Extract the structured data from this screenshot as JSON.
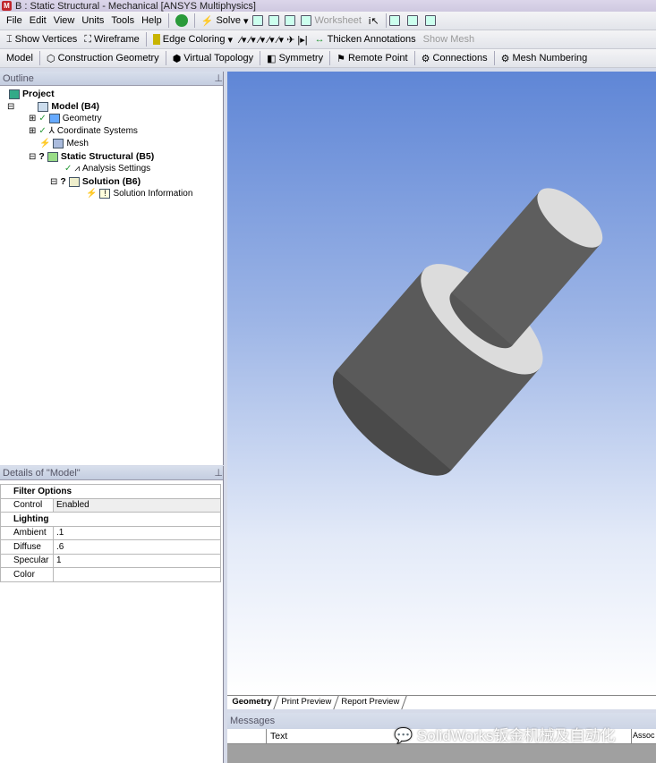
{
  "title": "B : Static Structural - Mechanical [ANSYS Multiphysics]",
  "menu": [
    "File",
    "Edit",
    "View",
    "Units",
    "Tools",
    "Help"
  ],
  "toolbar1": {
    "solve": "Solve",
    "worksheet": "Worksheet"
  },
  "toolbar2": {
    "show_vertices": "Show Vertices",
    "wireframe": "Wireframe",
    "edge_coloring": "Edge Coloring",
    "thicken": "Thicken Annotations",
    "show_mesh": "Show Mesh"
  },
  "toolbar3": [
    "Model",
    "Construction Geometry",
    "Virtual Topology",
    "Symmetry",
    "Remote Point",
    "Connections",
    "Mesh Numbering"
  ],
  "outline": {
    "title": "Outline",
    "pin": "⊥",
    "nodes": [
      "Project",
      "Model (B4)",
      "Geometry",
      "Coordinate Systems",
      "Mesh",
      "Static Structural (B5)",
      "Analysis Settings",
      "Solution (B6)",
      "Solution Information"
    ]
  },
  "details": {
    "title": "Details of \"Model\"",
    "pin": "⊥",
    "groups": [
      {
        "name": "Filter Options",
        "rows": [
          [
            "Control",
            "Enabled"
          ]
        ]
      },
      {
        "name": "Lighting",
        "rows": [
          [
            "Ambient",
            ".1"
          ],
          [
            "Diffuse",
            ".6"
          ],
          [
            "Specular",
            "1"
          ],
          [
            "Color",
            ""
          ]
        ]
      }
    ]
  },
  "tabs": [
    "Geometry",
    "Print Preview",
    "Report Preview"
  ],
  "messages": {
    "title": "Messages",
    "col_text": "Text",
    "col_assoc": "Assoc"
  },
  "watermark": "SolidWorks钣金机械及自动化"
}
